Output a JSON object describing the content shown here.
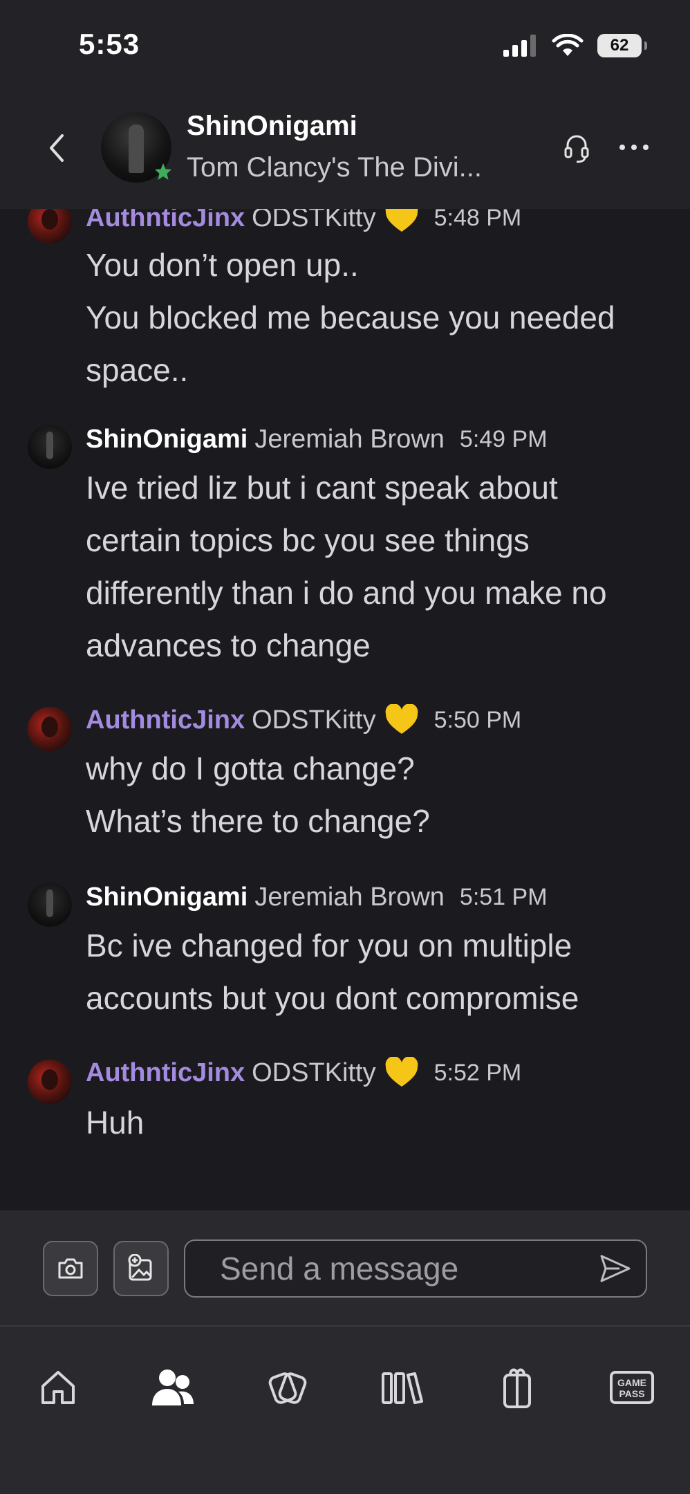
{
  "status_bar": {
    "time": "5:53",
    "battery": "62"
  },
  "header": {
    "name": "ShinOnigami",
    "status": "Tom Clancy's The Divi..."
  },
  "messages": [
    {
      "sender": "AuthnticJinx",
      "realname": "ODSTKitty",
      "time": "5:48 PM",
      "lines": [
        "You don’t open up..",
        "You blocked me because you needed",
        "space.."
      ]
    },
    {
      "sender": "ShinOnigami",
      "realname": "Jeremiah Brown",
      "time": "5:49 PM",
      "lines": [
        "Ive tried liz but i cant speak about",
        "certain topics bc you see things",
        "differently than i do and you make no",
        "advances to change"
      ]
    },
    {
      "sender": "AuthnticJinx",
      "realname": "ODSTKitty",
      "time": "5:50 PM",
      "lines": [
        "why do I gotta change?",
        "What’s there to change?"
      ]
    },
    {
      "sender": "ShinOnigami",
      "realname": "Jeremiah Brown",
      "time": "5:51 PM",
      "lines": [
        "Bc ive changed for you on multiple",
        "accounts but you dont compromise"
      ]
    },
    {
      "sender": "AuthnticJinx",
      "realname": "ODSTKitty",
      "time": "5:52 PM",
      "lines": [
        "Huh"
      ]
    }
  ],
  "composer": {
    "placeholder": "Send a message"
  },
  "nav": {
    "gamepass_line1": "GAME",
    "gamepass_line2": "PASS"
  },
  "colors": {
    "accent_gamertag": "#a58be0",
    "background": "#1b1b1f",
    "header_bg": "#232327",
    "presence": "#3fae5a",
    "heart": "#f5c518"
  },
  "icons": [
    "back-chevron-icon",
    "headset-icon",
    "more-icon",
    "camera-icon",
    "add-image-icon",
    "send-icon",
    "home-icon",
    "friends-icon",
    "store-icon",
    "library-icon",
    "gift-icon",
    "gamepass-icon"
  ]
}
